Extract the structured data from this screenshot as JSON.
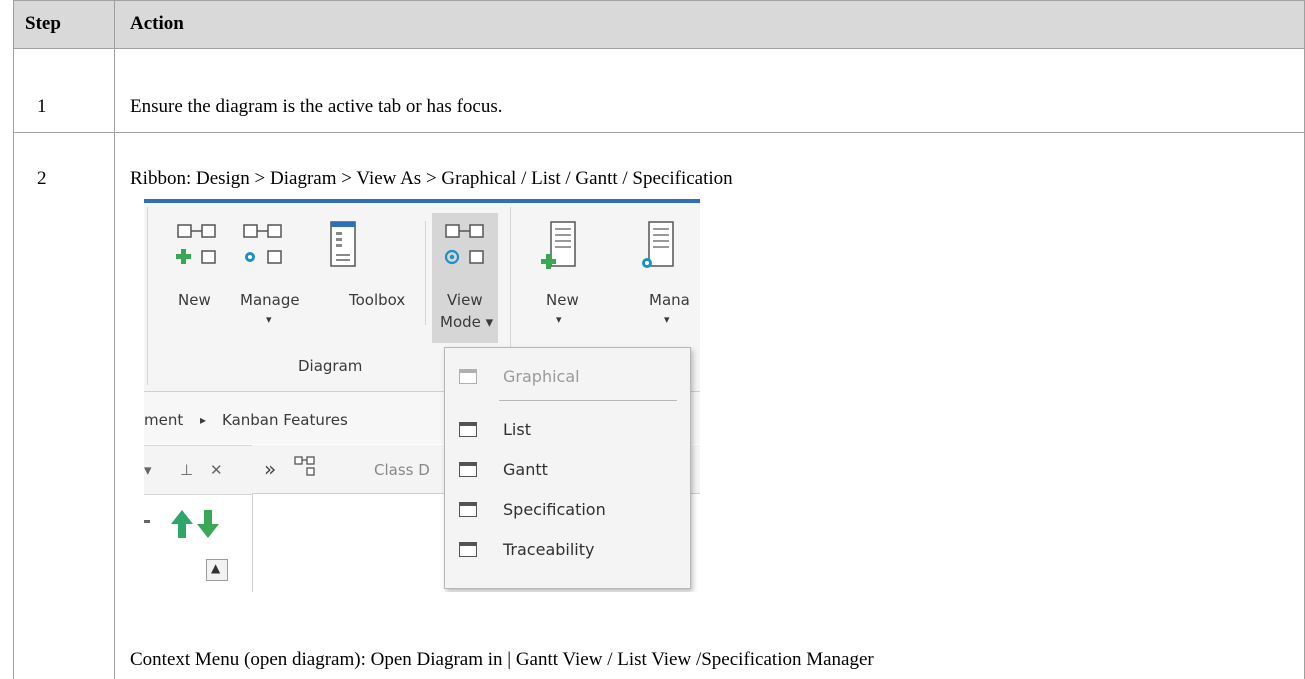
{
  "table": {
    "headers": [
      "Step",
      "Action"
    ],
    "rows": [
      {
        "step": "1",
        "action": "Ensure the diagram is the active tab or has focus."
      },
      {
        "step": "2",
        "action": "Ribbon: Design > Diagram > View As > Graphical / List / Gantt / Specification",
        "after": "Context Menu (open diagram): Open Diagram in | Gantt View / List View /Specification Manager"
      }
    ]
  },
  "ribbon": {
    "buttons": [
      {
        "line1": "New",
        "line2": ""
      },
      {
        "line1": "Manage",
        "line2": "▾"
      },
      {
        "line1": "Toolbox",
        "line2": ""
      },
      {
        "line1": "View",
        "line2": "Mode ▾"
      },
      {
        "line1": "New",
        "line2": "▾"
      },
      {
        "line1": "Mana",
        "line2": "▾"
      }
    ],
    "group_label": "Diagram",
    "breadcrumb": {
      "partial": "ment",
      "arrow": "▸",
      "item": "Kanban Features"
    },
    "dock_controls": {
      "menu": "▾",
      "pin": "⊥",
      "close": "✕"
    },
    "tab": {
      "chevrons": "»",
      "label": "Class D"
    },
    "scroll_arrow": "▲",
    "menu_items": [
      {
        "label": "Graphical",
        "enabled": false
      },
      {
        "label": "List",
        "enabled": true
      },
      {
        "label": "Gantt",
        "enabled": true
      },
      {
        "label": "Specification",
        "enabled": true
      },
      {
        "label": "Traceability",
        "enabled": true
      }
    ]
  },
  "colors": {
    "header_bg": "#d9d9d9",
    "grid": "#a0a0a0",
    "ribbon_accent": "#2f6fb7",
    "green": "#3aa757",
    "cyan": "#1e90c8"
  }
}
